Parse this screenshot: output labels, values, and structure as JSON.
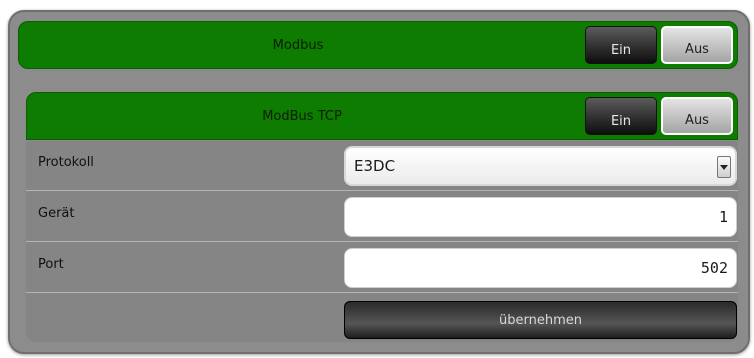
{
  "modbus": {
    "title": "Modbus",
    "on_label": "Ein",
    "off_label": "Aus"
  },
  "modbus_tcp": {
    "title": "ModBus TCP",
    "on_label": "Ein",
    "off_label": "Aus"
  },
  "form": {
    "protocol_label": "Protokoll",
    "protocol_value": "E3DC",
    "device_label": "Gerät",
    "device_value": "1",
    "port_label": "Port",
    "port_value": "502",
    "apply_label": "übernehmen"
  }
}
